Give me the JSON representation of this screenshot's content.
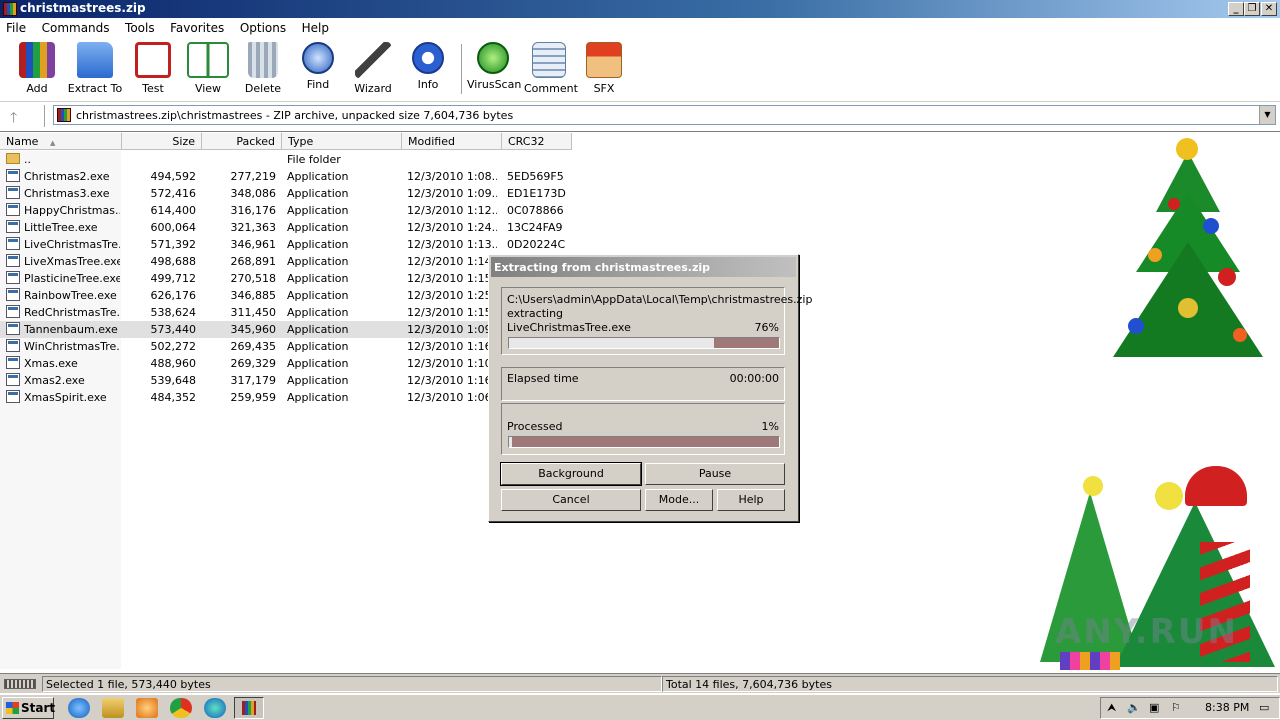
{
  "window": {
    "title": "christmastrees.zip",
    "minimize_glyph": "_",
    "restore_glyph": "❐",
    "close_glyph": "✕"
  },
  "menu": [
    "File",
    "Commands",
    "Tools",
    "Favorites",
    "Options",
    "Help"
  ],
  "toolbar": [
    {
      "label": "Add",
      "icon": "books-icon"
    },
    {
      "label": "Extract To",
      "icon": "folder-extract-icon"
    },
    {
      "label": "Test",
      "icon": "checklist-icon"
    },
    {
      "label": "View",
      "icon": "book-icon"
    },
    {
      "label": "Delete",
      "icon": "trash-icon"
    },
    {
      "label": "Find",
      "icon": "magnifier-icon"
    },
    {
      "label": "Wizard",
      "icon": "wand-icon"
    },
    {
      "label": "Info",
      "icon": "info-icon"
    },
    {
      "label": "VirusScan",
      "icon": "bug-icon"
    },
    {
      "label": "Comment",
      "icon": "comment-icon"
    },
    {
      "label": "SFX",
      "icon": "sfx-box-icon"
    }
  ],
  "address": {
    "up_glyph": "🡑",
    "path": "christmastrees.zip\\christmastrees - ZIP archive, unpacked size 7,604,736 bytes",
    "dropdown_glyph": "▼"
  },
  "columns": [
    "Name",
    "Size",
    "Packed",
    "Type",
    "Modified",
    "CRC32"
  ],
  "sort_glyph": "▲",
  "parent_row": {
    "name": "..",
    "type": "File folder"
  },
  "files": [
    {
      "name": "Christmas2.exe",
      "size": "494,592",
      "packed": "277,219",
      "type": "Application",
      "modified": "12/3/2010 1:08...",
      "crc": "5ED569F5"
    },
    {
      "name": "Christmas3.exe",
      "size": "572,416",
      "packed": "348,086",
      "type": "Application",
      "modified": "12/3/2010 1:09...",
      "crc": "ED1E173D"
    },
    {
      "name": "HappyChristmas....",
      "size": "614,400",
      "packed": "316,176",
      "type": "Application",
      "modified": "12/3/2010 1:12...",
      "crc": "0C078866"
    },
    {
      "name": "LittleTree.exe",
      "size": "600,064",
      "packed": "321,363",
      "type": "Application",
      "modified": "12/3/2010 1:24...",
      "crc": "13C24FA9"
    },
    {
      "name": "LiveChristmasTre...",
      "size": "571,392",
      "packed": "346,961",
      "type": "Application",
      "modified": "12/3/2010 1:13...",
      "crc": "0D20224C"
    },
    {
      "name": "LiveXmasTree.exe",
      "size": "498,688",
      "packed": "268,891",
      "type": "Application",
      "modified": "12/3/2010 1:14...",
      "crc": ""
    },
    {
      "name": "PlasticineTree.exe",
      "size": "499,712",
      "packed": "270,518",
      "type": "Application",
      "modified": "12/3/2010 1:15...",
      "crc": ""
    },
    {
      "name": "RainbowTree.exe",
      "size": "626,176",
      "packed": "346,885",
      "type": "Application",
      "modified": "12/3/2010 1:25...",
      "crc": ""
    },
    {
      "name": "RedChristmasTre...",
      "size": "538,624",
      "packed": "311,450",
      "type": "Application",
      "modified": "12/3/2010 1:15...",
      "crc": ""
    },
    {
      "name": "Tannenbaum.exe",
      "size": "573,440",
      "packed": "345,960",
      "type": "Application",
      "modified": "12/3/2010 1:09...",
      "crc": "",
      "selected": true
    },
    {
      "name": "WinChristmasTre...",
      "size": "502,272",
      "packed": "269,435",
      "type": "Application",
      "modified": "12/3/2010 1:16...",
      "crc": ""
    },
    {
      "name": "Xmas.exe",
      "size": "488,960",
      "packed": "269,329",
      "type": "Application",
      "modified": "12/3/2010 1:10...",
      "crc": ""
    },
    {
      "name": "Xmas2.exe",
      "size": "539,648",
      "packed": "317,179",
      "type": "Application",
      "modified": "12/3/2010 1:16...",
      "crc": ""
    },
    {
      "name": "XmasSpirit.exe",
      "size": "484,352",
      "packed": "259,959",
      "type": "Application",
      "modified": "12/3/2010 1:06...",
      "crc": ""
    }
  ],
  "dialog": {
    "title": "Extracting from christmastrees.zip",
    "archive_path": "C:\\Users\\admin\\AppData\\Local\\Temp\\christmastrees.zip",
    "action": "extracting",
    "current_file": "LiveChristmasTree.exe",
    "file_percent": "76%",
    "file_progress": 0.76,
    "elapsed_label": "Elapsed time",
    "elapsed_value": "00:00:00",
    "processed_label": "Processed",
    "processed_percent": "1%",
    "processed_progress": 0.01,
    "buttons": {
      "background": "Background",
      "pause": "Pause",
      "cancel": "Cancel",
      "mode": "Mode...",
      "help": "Help"
    }
  },
  "status": {
    "left": "Selected 1 file, 573,440 bytes",
    "right": "Total 14 files, 7,604,736 bytes"
  },
  "taskbar": {
    "start": "Start",
    "clock": "8:38 PM",
    "tray_glyphs": [
      "⮝",
      "🔈",
      "▣",
      "⚐",
      "▭"
    ]
  },
  "watermark": "ANY.RUN",
  "colors": {
    "progress": "#a07878",
    "titlebar": "#0a246a"
  }
}
